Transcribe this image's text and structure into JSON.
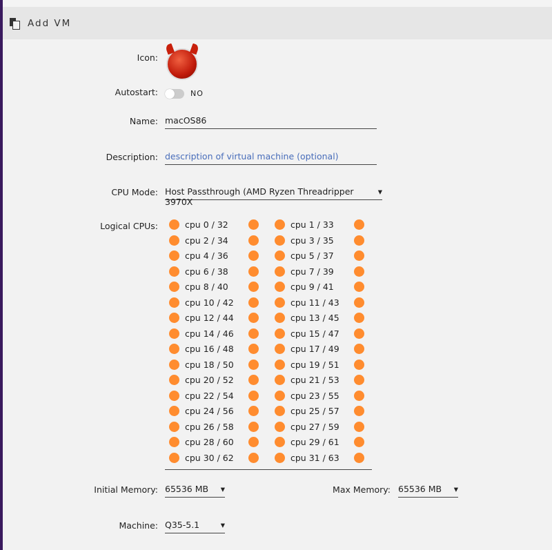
{
  "header": {
    "title": "Add VM"
  },
  "form": {
    "icon_label": "Icon:",
    "autostart_label": "Autostart:",
    "autostart_value": "NO",
    "name_label": "Name:",
    "name_value": "macOS86",
    "description_label": "Description:",
    "description_placeholder": "description of virtual machine (optional)",
    "cpu_mode_label": "CPU Mode:",
    "cpu_mode_value": "Host Passthrough (AMD Ryzen Threadripper 3970X",
    "logical_cpus_label": "Logical CPUs:",
    "cpus": [
      "cpu 0 / 32",
      "cpu 1 / 33",
      "cpu 2 / 34",
      "cpu 3 / 35",
      "cpu 4 / 36",
      "cpu 5 / 37",
      "cpu 6 / 38",
      "cpu 7 / 39",
      "cpu 8 / 40",
      "cpu 9 / 41",
      "cpu 10 / 42",
      "cpu 11 / 43",
      "cpu 12 / 44",
      "cpu 13 / 45",
      "cpu 14 / 46",
      "cpu 15 / 47",
      "cpu 16 / 48",
      "cpu 17 / 49",
      "cpu 18 / 50",
      "cpu 19 / 51",
      "cpu 20 / 52",
      "cpu 21 / 53",
      "cpu 22 / 54",
      "cpu 23 / 55",
      "cpu 24 / 56",
      "cpu 25 / 57",
      "cpu 26 / 58",
      "cpu 27 / 59",
      "cpu 28 / 60",
      "cpu 29 / 61",
      "cpu 30 / 62",
      "cpu 31 / 63"
    ],
    "initial_memory_label": "Initial Memory:",
    "initial_memory_value": "65536 MB",
    "max_memory_label": "Max Memory:",
    "max_memory_value": "65536 MB",
    "machine_label": "Machine:",
    "machine_value": "Q35-5.1",
    "dropdown_arrow": "▾"
  },
  "colors": {
    "accent": "#ff8c2f"
  }
}
